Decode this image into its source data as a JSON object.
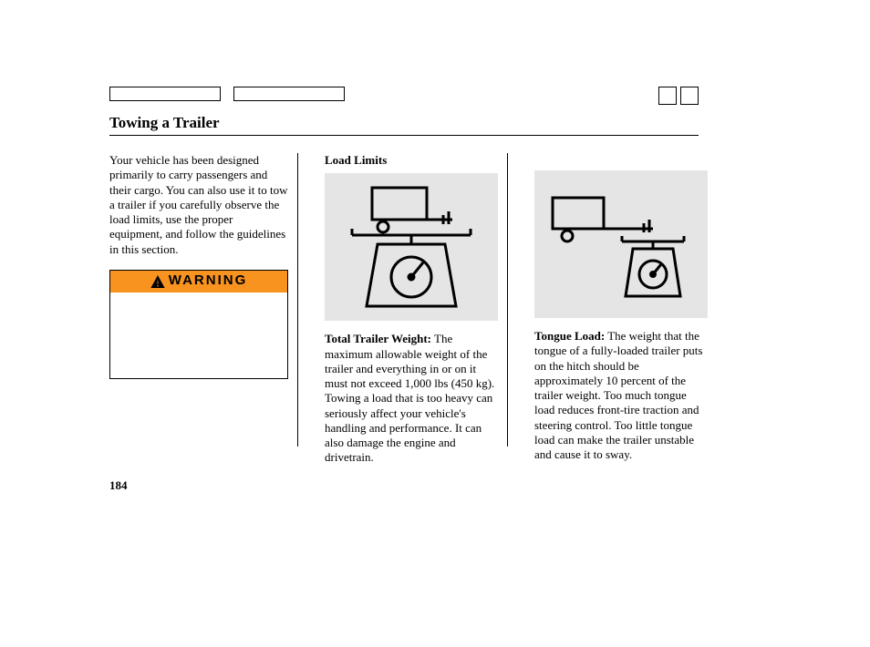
{
  "title": "Towing a Trailer",
  "page_number": "184",
  "intro": "Your vehicle has been designed primarily to carry passengers and their cargo. You can also use it to tow a trailer if you carefully observe the load limits, use the proper equipment, and follow the guidelines in this section.",
  "warning": {
    "label": "WARNING"
  },
  "section_heading": "Load Limits",
  "total_trailer": {
    "label": "Total Trailer Weight:",
    "text": " The maximum allowable weight of the trailer and everything in or on it must not exceed 1,000 lbs (450 kg). Towing a load that is too heavy can seriously affect your vehicle's handling and performance. It can also damage the engine and drivetrain."
  },
  "tongue_load": {
    "label": "Tongue Load:",
    "text": " The weight that the tongue of a fully-loaded trailer puts on the hitch should be approximately 10 percent of the trailer weight. Too much tongue load reduces front-tire traction and steering control. Too little tongue load can make the trailer unstable and cause it to sway."
  }
}
